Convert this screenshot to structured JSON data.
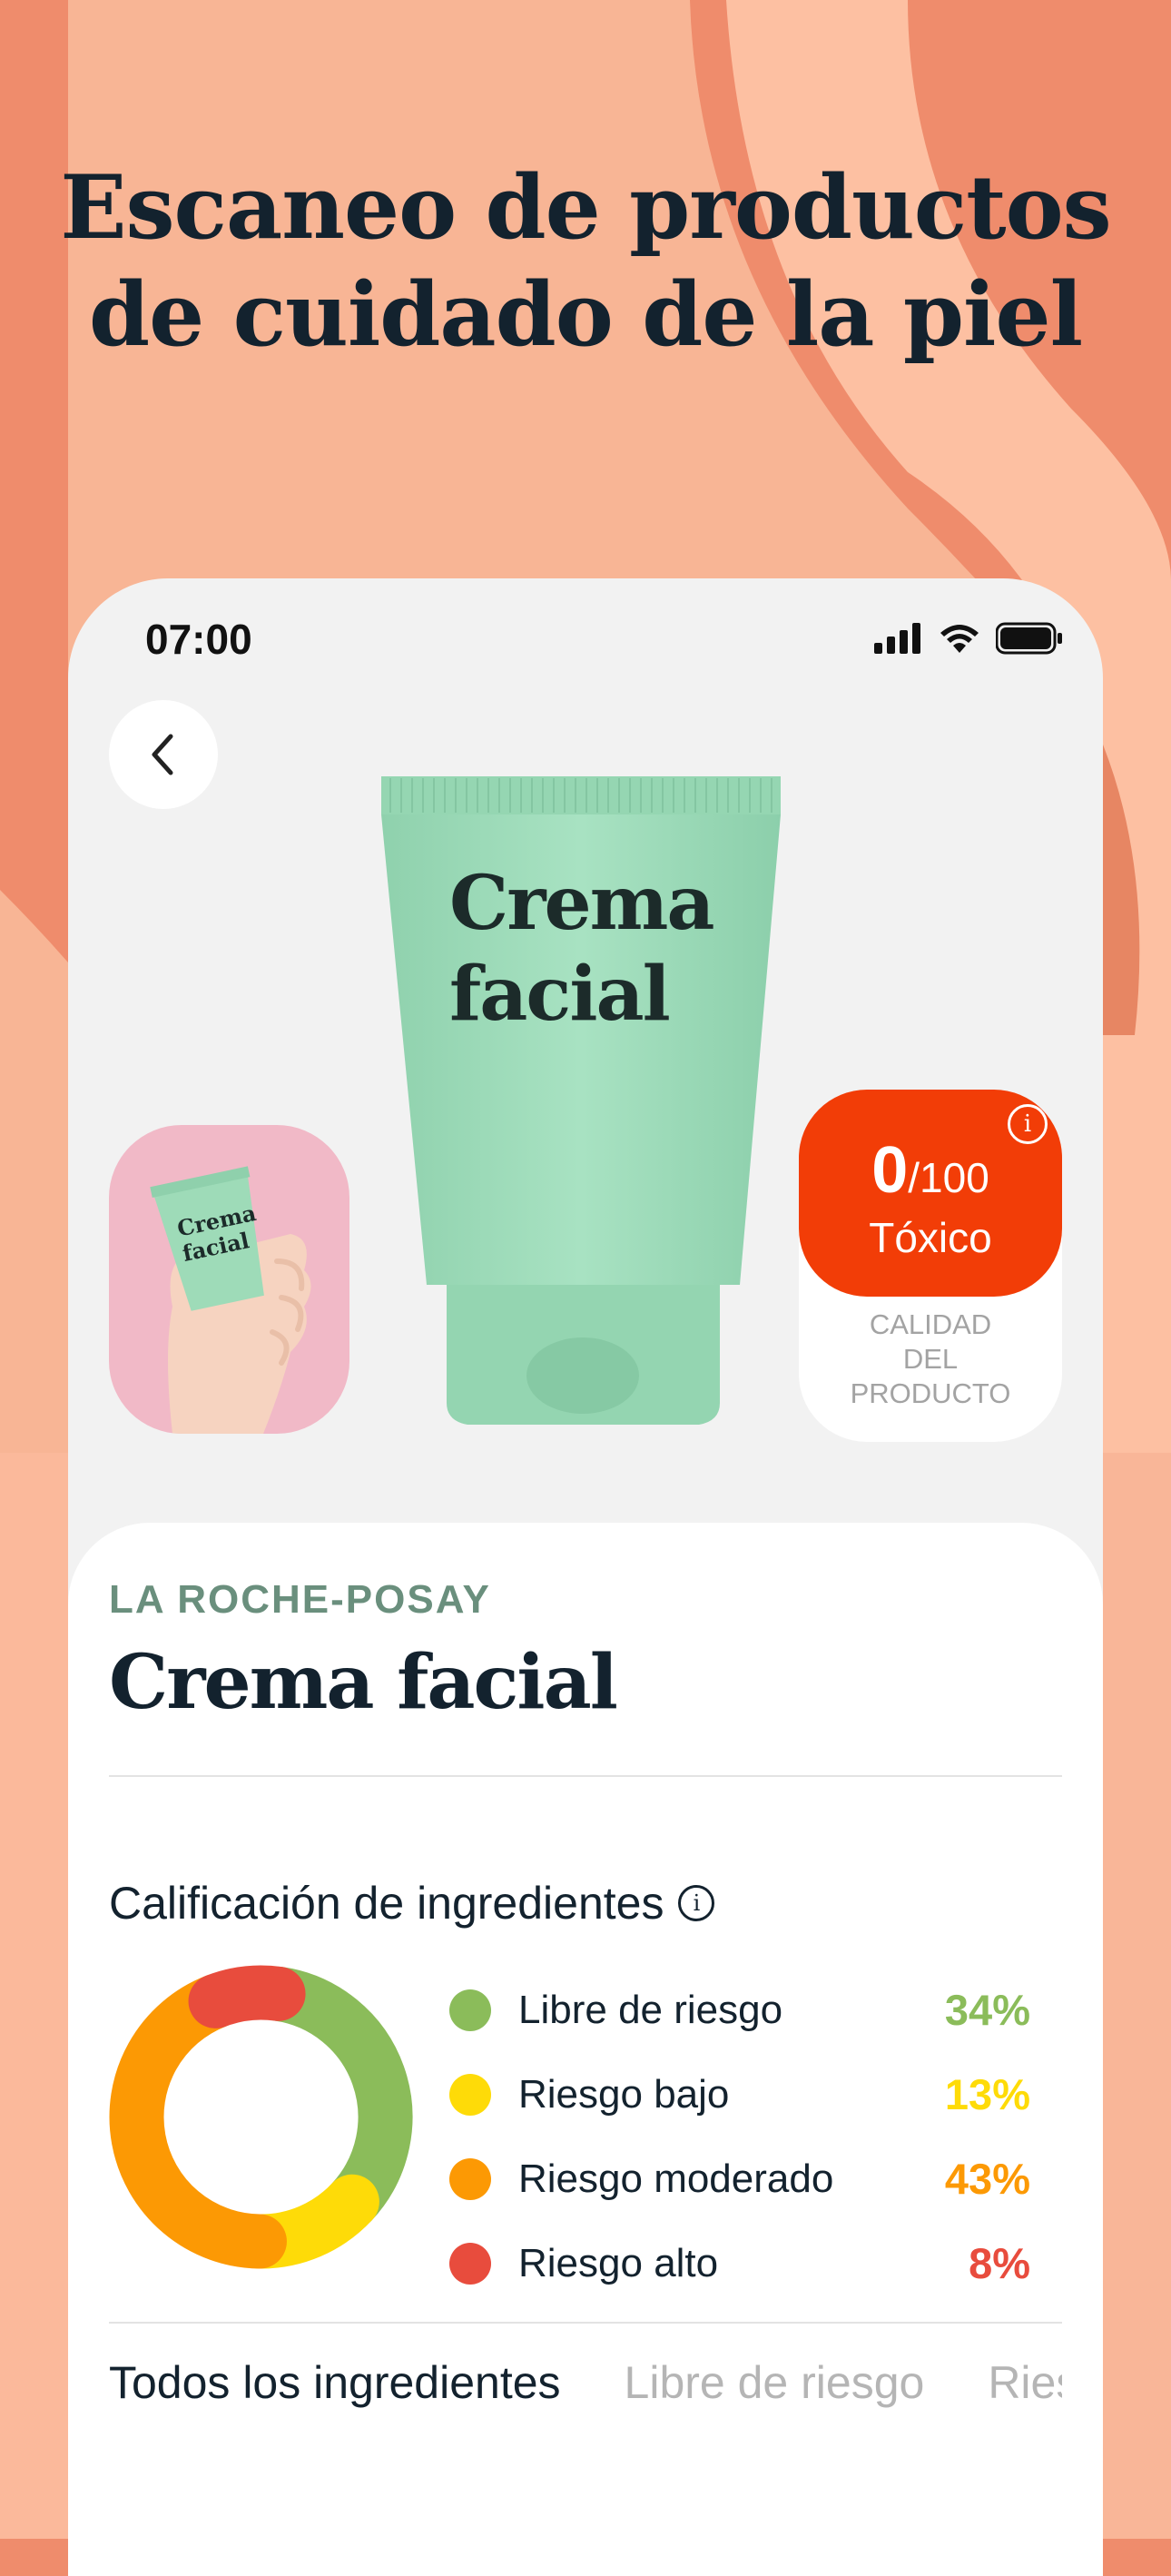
{
  "headline": {
    "line1": "Escaneo de productos",
    "line2": "de cuidado de la piel"
  },
  "status_bar": {
    "time": "07:00",
    "icons": [
      "signal-icon",
      "wifi-icon",
      "battery-icon"
    ]
  },
  "product_image": {
    "tube_text_line1": "Crema",
    "tube_text_line2": "facial",
    "thumb_text_line1": "Crema",
    "thumb_text_line2": "facial"
  },
  "score": {
    "value": "0",
    "max": "/100",
    "status": "Tóxico",
    "caption_line1": "CALIDAD",
    "caption_line2": "DEL",
    "caption_line3": "PRODUCTO",
    "color": "#f23d07"
  },
  "product": {
    "brand": "LA ROCHE-POSAY",
    "name": "Crema facial"
  },
  "ingredients": {
    "title": "Calificación de ingredientes",
    "items": [
      {
        "label": "Libre de riesgo",
        "percent": "34%",
        "value": 34,
        "color": "#8bbc5a"
      },
      {
        "label": "Riesgo bajo",
        "percent": "13%",
        "value": 13,
        "color": "#fedb08"
      },
      {
        "label": "Riesgo moderado",
        "percent": "43%",
        "value": 43,
        "color": "#fc9904"
      },
      {
        "label": "Riesgo alto",
        "percent": "8%",
        "value": 8,
        "color": "#e84c3d"
      }
    ]
  },
  "tabs": [
    {
      "label": "Todos los ingredientes"
    },
    {
      "label": "Libre de riesgo"
    },
    {
      "label": "Riesgo bajo"
    }
  ]
}
